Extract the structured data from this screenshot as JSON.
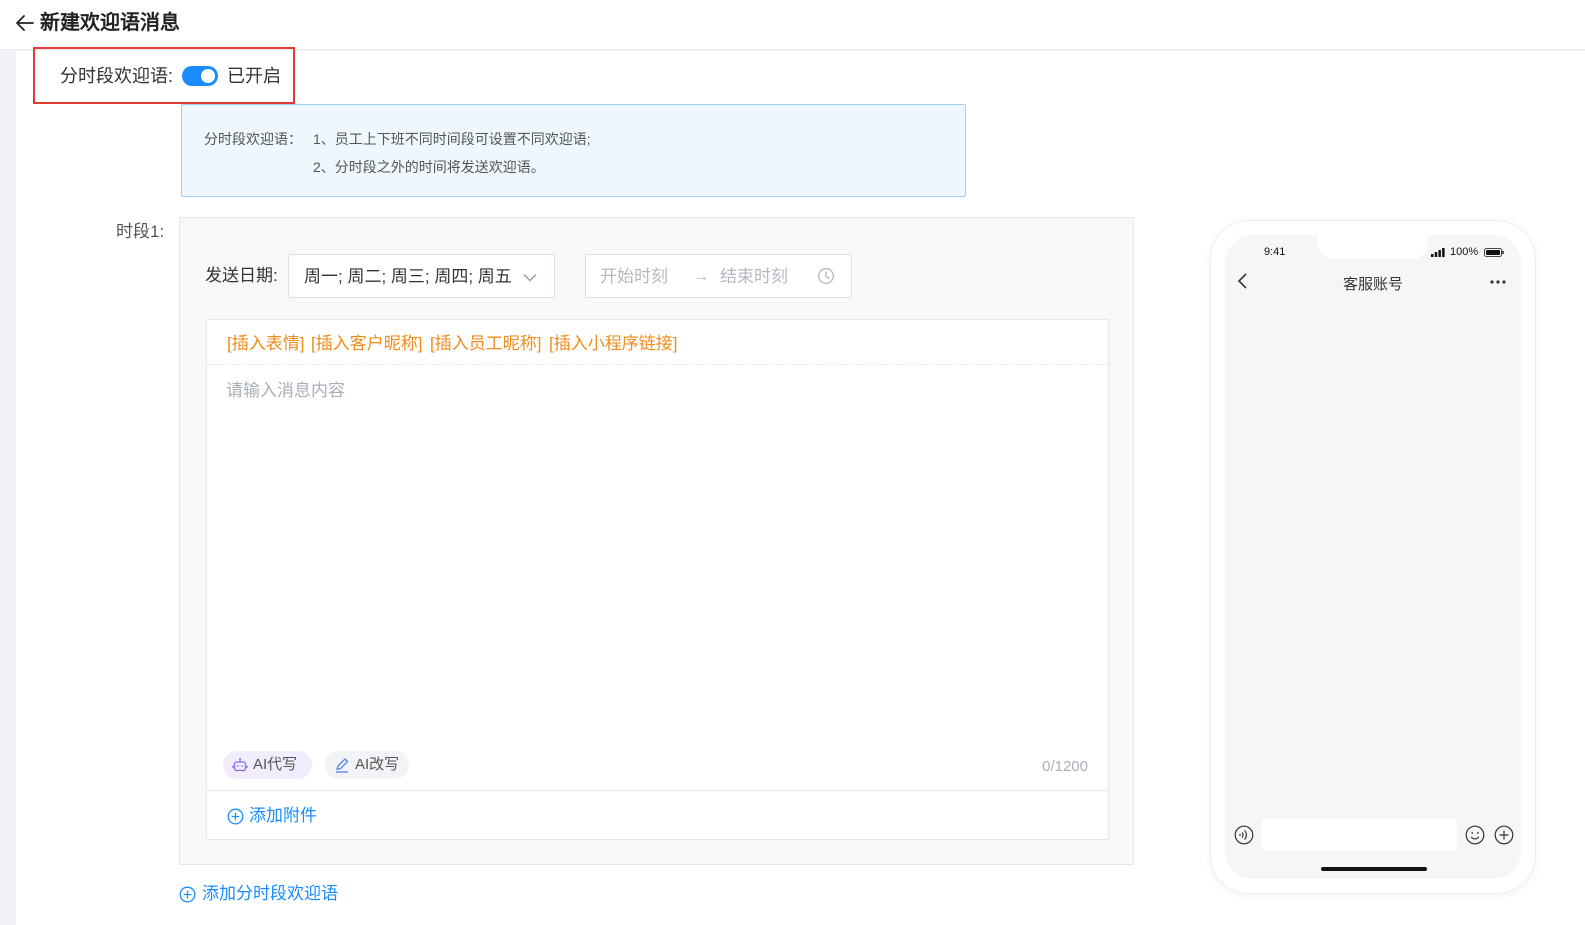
{
  "header": {
    "title": "新建欢迎语消息"
  },
  "toggle": {
    "label": "分时段欢迎语:",
    "state_text": "已开启",
    "enabled": true
  },
  "info": {
    "prefix": "分时段欢迎语：",
    "line1": "1、员工上下班不同时间段可设置不同欢迎语;",
    "line2": "2、分时段之外的时间将发送欢迎语。"
  },
  "segment": {
    "label": "时段1:",
    "send_date_label": "发送日期:",
    "days_value": "周一; 周二; 周三; 周四; 周五",
    "start_placeholder": "开始时刻",
    "end_placeholder": "结束时刻",
    "range_separator": "→"
  },
  "editor": {
    "inserts": [
      "[插入表情]",
      "[插入客户昵称]",
      "[插入员工昵称]",
      "[插入小程序链接]"
    ],
    "placeholder": "请输入消息内容",
    "ai_write": "AI代写",
    "ai_rewrite": "AI改写",
    "char_count": "0/1200",
    "add_attachment": "添加附件"
  },
  "add_segment": "添加分时段欢迎语",
  "phone": {
    "time": "9:41",
    "battery": "100%",
    "chat_title": "客服账号"
  },
  "colors": {
    "accent": "#1a8cff",
    "insert_orange": "#f08c1c",
    "highlight_red": "#e53935"
  }
}
